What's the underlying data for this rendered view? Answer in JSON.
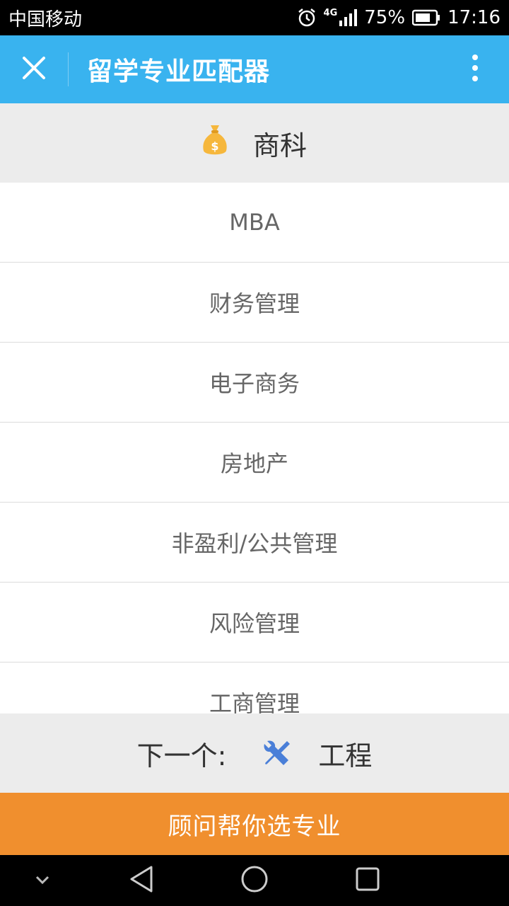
{
  "status_bar": {
    "carrier": "中国移动",
    "network": "4G",
    "battery": "75%",
    "time": "17:16"
  },
  "title_bar": {
    "title": "留学专业匹配器",
    "close_icon": "close-icon",
    "more_icon": "more-vertical-icon"
  },
  "category": {
    "icon": "money-bag-icon",
    "name": "商科"
  },
  "majors": [
    "MBA",
    "财务管理",
    "电子商务",
    "房地产",
    "非盈利/公共管理",
    "风险管理",
    "工商管理"
  ],
  "next": {
    "label": "下一个:",
    "icon": "tools-icon",
    "name": "工程"
  },
  "advisor_button": "顾问帮你选专业",
  "colors": {
    "accent": "#39b3ef",
    "cta": "#f08f2e",
    "bag": "#f6b73c",
    "tools": "#4a7fd8"
  }
}
